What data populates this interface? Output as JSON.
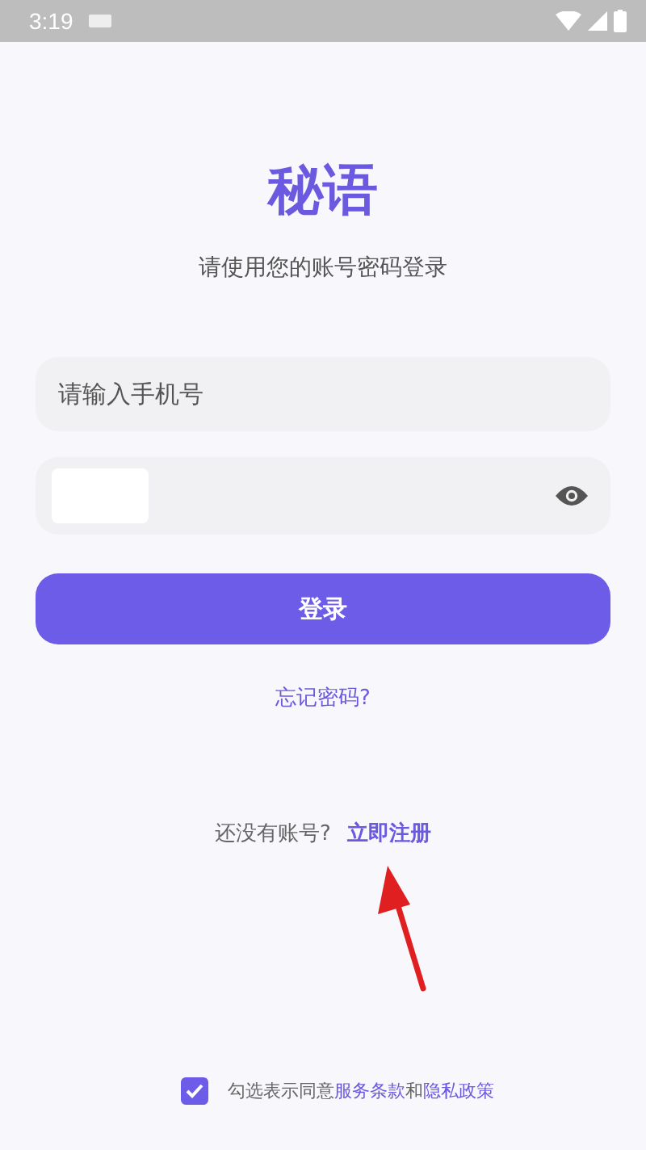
{
  "status_bar": {
    "time": "3:19"
  },
  "app_title": "秘语",
  "subtitle": "请使用您的账号密码登录",
  "phone_field": {
    "placeholder": "请输入手机号"
  },
  "login_button": "登录",
  "forgot_link": "忘记密码?",
  "register": {
    "prompt": "还没有账号?",
    "link": "立即注册"
  },
  "agreement": {
    "checked": true,
    "text": "勾选表示同意",
    "terms_link": "服务条款",
    "joiner": "和",
    "privacy_link": "隐私政策"
  }
}
